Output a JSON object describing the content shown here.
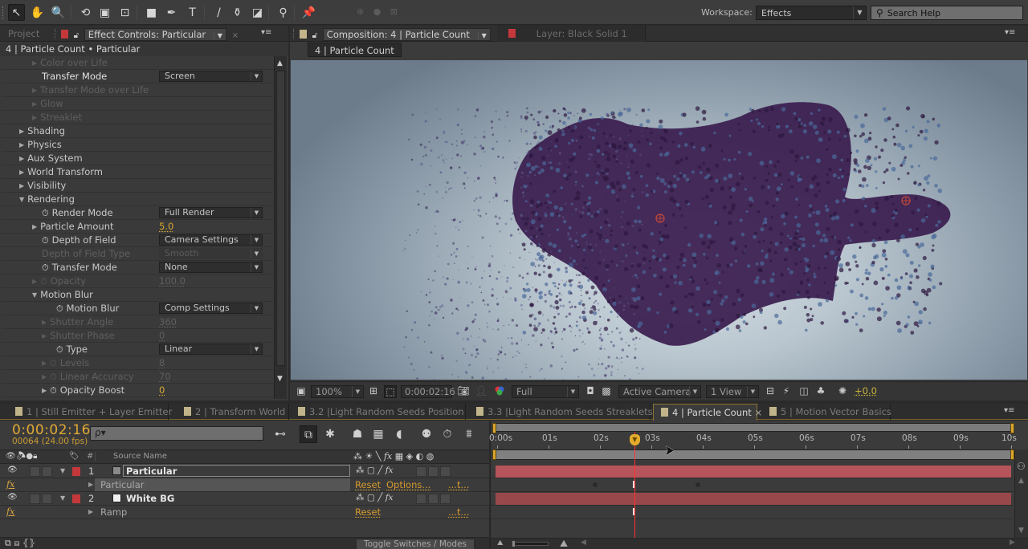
{
  "toolbar": {
    "tools": [
      {
        "name": "selection-tool",
        "glyph": "↖",
        "active": true
      },
      {
        "name": "hand-tool",
        "glyph": "✋"
      },
      {
        "name": "zoom-tool",
        "glyph": "🔍"
      },
      {
        "name": "rotation-tool",
        "glyph": "⟲"
      },
      {
        "name": "camera-tool",
        "glyph": "▣"
      },
      {
        "name": "pan-behind-tool",
        "glyph": "⊡"
      },
      {
        "name": "rectangle-tool",
        "glyph": "■"
      },
      {
        "name": "pen-tool",
        "glyph": "✒"
      },
      {
        "name": "type-tool",
        "glyph": "T"
      },
      {
        "name": "brush-tool",
        "glyph": "/"
      },
      {
        "name": "clone-stamp-tool",
        "glyph": "⚱"
      },
      {
        "name": "eraser-tool",
        "glyph": "◪"
      },
      {
        "name": "roto-brush-tool",
        "glyph": "⚲"
      },
      {
        "name": "puppet-pin-tool",
        "glyph": "📌"
      }
    ],
    "axis_icons": "⊕ ● ⊠",
    "workspace_label": "Workspace:",
    "workspace_value": "Effects",
    "search_placeholder": "Search Help"
  },
  "effect_controls": {
    "tab_project": "Project",
    "tab_title": "Effect Controls: Particular",
    "header": "4 | Particle Count • Particular",
    "rows": [
      {
        "indent": 2,
        "tri": "▶",
        "label": "Color over Life",
        "dim": true
      },
      {
        "indent": 3,
        "label": "Transfer Mode",
        "dropdown": "Screen",
        "bright": true
      },
      {
        "indent": 2,
        "tri": "▶",
        "label": "Transfer Mode over Life",
        "dim": true
      },
      {
        "indent": 2,
        "tri": "▶",
        "label": "Glow",
        "dim": true
      },
      {
        "indent": 2,
        "tri": "▶",
        "label": "Streaklet",
        "dim": true
      },
      {
        "indent": 1,
        "tri": "▶",
        "label": "Shading"
      },
      {
        "indent": 1,
        "tri": "▶",
        "label": "Physics"
      },
      {
        "indent": 1,
        "tri": "▶",
        "label": "Aux System"
      },
      {
        "indent": 1,
        "tri": "▶",
        "label": "World Transform"
      },
      {
        "indent": 1,
        "tri": "▶",
        "label": "Visibility"
      },
      {
        "indent": 1,
        "tri": "▼",
        "label": "Rendering"
      },
      {
        "indent": 3,
        "stopwatch": true,
        "label": "Render Mode",
        "dropdown": "Full Render"
      },
      {
        "indent": 2,
        "tri": "▶",
        "label": "Particle Amount",
        "value": "5.0",
        "value_style": "orange"
      },
      {
        "indent": 3,
        "stopwatch": true,
        "label": "Depth of Field",
        "dropdown": "Camera Settings"
      },
      {
        "indent": 3,
        "label": "Depth of Field Type",
        "dropdown": "Smooth",
        "dim": true
      },
      {
        "indent": 3,
        "stopwatch": true,
        "label": "Transfer Mode",
        "dropdown": "None"
      },
      {
        "indent": 2,
        "tri": "▶",
        "stopwatch": true,
        "label": "Opacity",
        "value": "100.0",
        "dim": true,
        "value_style": "dimnum"
      },
      {
        "indent": 2,
        "tri": "▼",
        "label": "Motion Blur"
      },
      {
        "indent": 4,
        "stopwatch": true,
        "label": "Motion Blur",
        "dropdown": "Comp Settings"
      },
      {
        "indent": 3,
        "tri": "▶",
        "label": "Shutter Angle",
        "value": "360",
        "dim": true,
        "value_style": "dimnum"
      },
      {
        "indent": 3,
        "tri": "▶",
        "label": "Shutter Phase",
        "value": "0",
        "dim": true,
        "value_style": "dimnum"
      },
      {
        "indent": 4,
        "stopwatch": true,
        "label": "Type",
        "dropdown": "Linear"
      },
      {
        "indent": 3,
        "tri": "▶",
        "stopwatch": true,
        "label": "Levels",
        "value": "8",
        "dim": true,
        "value_style": "dimnum"
      },
      {
        "indent": 3,
        "tri": "▶",
        "stopwatch": true,
        "label": "Linear Accuracy",
        "value": "70",
        "dim": true,
        "value_style": "dimnum"
      },
      {
        "indent": 3,
        "tri": "▶",
        "stopwatch": true,
        "label": "Opacity Boost",
        "value": "0",
        "value_style": "orange"
      }
    ]
  },
  "composition": {
    "tab_title": "Composition: 4 | Particle Count",
    "layer_tab": "Layer: Black Solid 1",
    "breadcrumb": "4 | Particle Count",
    "footer": {
      "magnification": "100%",
      "timecode": "0:00:02:16",
      "resolution": "Full",
      "camera": "Active Camera",
      "views": "1 View",
      "exposure": "+0.0"
    }
  },
  "timeline": {
    "tabs": [
      {
        "label": "1 | Still Emitter + Layer Emitter"
      },
      {
        "label": "2 | Transform World"
      },
      {
        "label": "3.2 |Light Random Seeds Position"
      },
      {
        "label": "3.3 |Light Random Seeds Streaklets"
      },
      {
        "label": "4 | Particle Count",
        "active": true
      },
      {
        "label": "5 | Motion Vector Basics"
      }
    ],
    "current_time": "0:00:02:16",
    "frame_info": "00064 (24.00 fps)",
    "search_placeholder": "ρ▾",
    "column_source_name": "Source Name",
    "column_hash": "#",
    "ruler_labels": [
      "0:00s",
      "01s",
      "02s",
      "03s",
      "04s",
      "05s",
      "06s",
      "07s",
      "08s",
      "09s",
      "10s"
    ],
    "playhead_seconds": 2.67,
    "duration_seconds": 10,
    "layers": [
      {
        "num": "1",
        "name": "Particular",
        "selected": true,
        "swatch": "#8a8a8a",
        "effect": "Particular",
        "effect_links": [
          "Reset",
          "Options...",
          "...t..."
        ],
        "keyframes_seconds": [
          1.9,
          3.9
        ]
      },
      {
        "num": "2",
        "name": "White BG",
        "swatch": "#f0f0f0",
        "effect": "Ramp",
        "effect_links": [
          "Reset",
          "",
          "...t..."
        ],
        "keyframes_seconds": []
      }
    ],
    "toggle_label": "Toggle Switches / Modes",
    "colors": {
      "layer1_bar": "#b5545a",
      "layer2_bar": "#98484a",
      "label_red": "#c4383b",
      "accent_orange": "#e0a934"
    }
  }
}
